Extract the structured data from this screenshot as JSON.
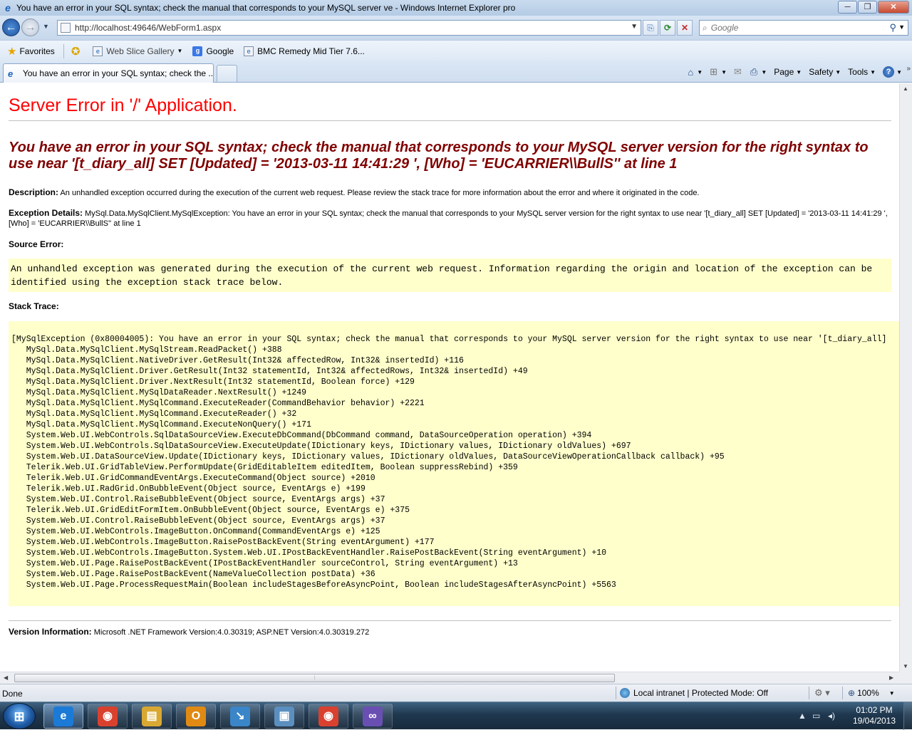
{
  "window": {
    "title": "You have an error in your SQL syntax; check the manual that corresponds to your MySQL server ve - Windows Internet Explorer pro",
    "minimize_label": "─",
    "maximize_label": "❐",
    "close_label": "✕"
  },
  "navbar": {
    "address": "http://localhost:49646/WebForm1.aspx",
    "search_placeholder": "Google"
  },
  "favorites_bar": {
    "favorites_label": "Favorites",
    "items": [
      {
        "label": "Web Slice Gallery",
        "icon": "web-slice-icon",
        "has_dropdown": true
      },
      {
        "label": "Google",
        "icon": "google-icon",
        "has_dropdown": false
      },
      {
        "label": "BMC Remedy Mid Tier 7.6...",
        "icon": "ie-page-icon",
        "has_dropdown": false
      }
    ]
  },
  "tabs": [
    {
      "label": "You have an error in your SQL syntax; check the ...",
      "active": true
    }
  ],
  "command_bar": {
    "page_label": "Page",
    "safety_label": "Safety",
    "tools_label": "Tools"
  },
  "page": {
    "heading": "Server Error in '/' Application.",
    "error_message": "You have an error in your SQL syntax; check the manual that corresponds to your MySQL server version for the right syntax to use near '[t_diary_all] SET [Updated] = '2013-03-11 14:41:29 ', [Who] = 'EUCARRIER\\\\BullS'' at line 1",
    "description_label": "Description:",
    "description_text": "An unhandled exception occurred during the execution of the current web request. Please review the stack trace for more information about the error and where it originated in the code.",
    "exception_label": "Exception Details:",
    "exception_text": "MySql.Data.MySqlClient.MySqlException: You have an error in your SQL syntax; check the manual that corresponds to your MySQL server version for the right syntax to use near '[t_diary_all] SET [Updated] = '2013-03-11 14:41:29 ', [Who] = 'EUCARRIER\\\\BullS'' at line 1",
    "source_error_label": "Source Error:",
    "source_error_text": "An unhandled exception was generated during the execution of the current web request. Information regarding the origin and location of the exception can be identified using the exception stack trace below.",
    "stack_trace_label": "Stack Trace:",
    "stack_trace": [
      "[MySqlException (0x80004005): You have an error in your SQL syntax; check the manual that corresponds to your MySQL server version for the right syntax to use near '[t_diary_all]",
      "   MySql.Data.MySqlClient.MySqlStream.ReadPacket() +388",
      "   MySql.Data.MySqlClient.NativeDriver.GetResult(Int32& affectedRow, Int32& insertedId) +116",
      "   MySql.Data.MySqlClient.Driver.GetResult(Int32 statementId, Int32& affectedRows, Int32& insertedId) +49",
      "   MySql.Data.MySqlClient.Driver.NextResult(Int32 statementId, Boolean force) +129",
      "   MySql.Data.MySqlClient.MySqlDataReader.NextResult() +1249",
      "   MySql.Data.MySqlClient.MySqlCommand.ExecuteReader(CommandBehavior behavior) +2221",
      "   MySql.Data.MySqlClient.MySqlCommand.ExecuteReader() +32",
      "   MySql.Data.MySqlClient.MySqlCommand.ExecuteNonQuery() +171",
      "   System.Web.UI.WebControls.SqlDataSourceView.ExecuteDbCommand(DbCommand command, DataSourceOperation operation) +394",
      "   System.Web.UI.WebControls.SqlDataSourceView.ExecuteUpdate(IDictionary keys, IDictionary values, IDictionary oldValues) +697",
      "   System.Web.UI.DataSourceView.Update(IDictionary keys, IDictionary values, IDictionary oldValues, DataSourceViewOperationCallback callback) +95",
      "   Telerik.Web.UI.GridTableView.PerformUpdate(GridEditableItem editedItem, Boolean suppressRebind) +359",
      "   Telerik.Web.UI.GridCommandEventArgs.ExecuteCommand(Object source) +2010",
      "   Telerik.Web.UI.RadGrid.OnBubbleEvent(Object source, EventArgs e) +199",
      "   System.Web.UI.Control.RaiseBubbleEvent(Object source, EventArgs args) +37",
      "   Telerik.Web.UI.GridEditFormItem.OnBubbleEvent(Object source, EventArgs e) +375",
      "   System.Web.UI.Control.RaiseBubbleEvent(Object source, EventArgs args) +37",
      "   System.Web.UI.WebControls.ImageButton.OnCommand(CommandEventArgs e) +125",
      "   System.Web.UI.WebControls.ImageButton.RaisePostBackEvent(String eventArgument) +177",
      "   System.Web.UI.WebControls.ImageButton.System.Web.UI.IPostBackEventHandler.RaisePostBackEvent(String eventArgument) +10",
      "   System.Web.UI.Page.RaisePostBackEvent(IPostBackEventHandler sourceControl, String eventArgument) +13",
      "   System.Web.UI.Page.RaisePostBackEvent(NameValueCollection postData) +36",
      "   System.Web.UI.Page.ProcessRequestMain(Boolean includeStagesBeforeAsyncPoint, Boolean includeStagesAfterAsyncPoint) +5563"
    ],
    "version_label": "Version Information:",
    "version_text": "Microsoft .NET Framework Version:4.0.30319; ASP.NET Version:4.0.30319.272"
  },
  "statusbar": {
    "status": "Done",
    "zone": "Local intranet | Protected Mode: Off",
    "zoom": "100%"
  },
  "taskbar": {
    "apps": [
      {
        "name": "internet-explorer",
        "glyph": "e",
        "color": "#1b7ad6",
        "active": true
      },
      {
        "name": "chrome",
        "glyph": "◉",
        "color": "#d9412f",
        "active": false
      },
      {
        "name": "file-explorer",
        "glyph": "▤",
        "color": "#d9a832",
        "active": false
      },
      {
        "name": "outlook",
        "glyph": "O",
        "color": "#e08a14",
        "active": false
      },
      {
        "name": "remote-app",
        "glyph": "↘",
        "color": "#3a86c8",
        "active": false
      },
      {
        "name": "remote-desktop",
        "glyph": "▣",
        "color": "#5b8fbf",
        "active": false
      },
      {
        "name": "chrome",
        "glyph": "◉",
        "color": "#d9412f",
        "active": false
      },
      {
        "name": "visual-studio",
        "glyph": "∞",
        "color": "#6a4fb3",
        "active": false
      }
    ],
    "time": "01:02 PM",
    "date": "19/04/2013"
  },
  "colors": {
    "heading": "#ff0000",
    "error_message": "#800000",
    "code_background": "#ffffcc"
  }
}
